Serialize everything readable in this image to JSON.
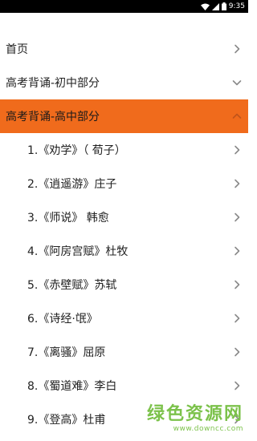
{
  "status_bar": {
    "time": "9:35",
    "icons": [
      "wifi-icon",
      "signal-icon",
      "battery-icon"
    ]
  },
  "menu": {
    "items": [
      {
        "label": "首页",
        "arrow": "chevron-right"
      },
      {
        "label": "高考背诵-初中部分",
        "arrow": "chevron-down"
      },
      {
        "label": "高考背诵-高中部分",
        "arrow": "chevron-up",
        "active": true
      }
    ],
    "children": [
      {
        "label": "1.《劝学》（ 荀子）"
      },
      {
        "label": "2.《逍遥游》庄子"
      },
      {
        "label": "3.《师说》 韩愈"
      },
      {
        "label": "4.《阿房宫赋》杜牧"
      },
      {
        "label": "5.《赤壁赋》苏轼"
      },
      {
        "label": "6.《诗经·氓》"
      },
      {
        "label": "7.《离骚》屈原"
      },
      {
        "label": "8.《蜀道难》李白"
      },
      {
        "label": "9.《登高》杜甫"
      }
    ]
  },
  "colors": {
    "active_background": "#f06b1c",
    "arrow": "#8a8a8a",
    "watermark": "#7cc24b"
  },
  "watermark": {
    "title": "绿色资源网",
    "url": "www.downcc.com"
  }
}
